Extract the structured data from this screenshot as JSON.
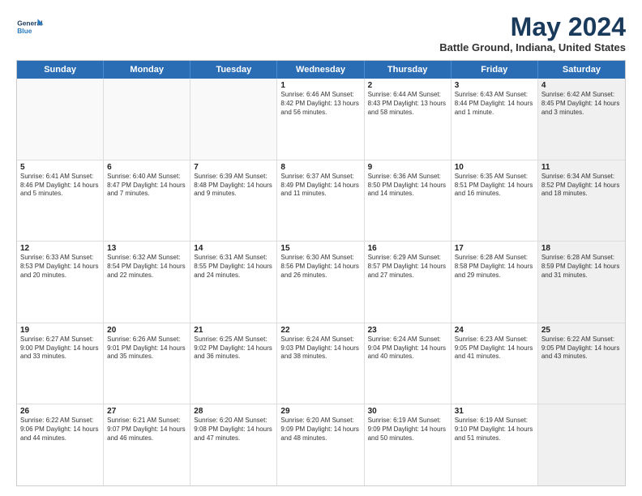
{
  "logo": {
    "line1": "General",
    "line2": "Blue"
  },
  "title": "May 2024",
  "subtitle": "Battle Ground, Indiana, United States",
  "header_days": [
    "Sunday",
    "Monday",
    "Tuesday",
    "Wednesday",
    "Thursday",
    "Friday",
    "Saturday"
  ],
  "rows": [
    [
      {
        "day": "",
        "text": "",
        "empty": true
      },
      {
        "day": "",
        "text": "",
        "empty": true
      },
      {
        "day": "",
        "text": "",
        "empty": true
      },
      {
        "day": "1",
        "text": "Sunrise: 6:46 AM\nSunset: 8:42 PM\nDaylight: 13 hours and 56 minutes."
      },
      {
        "day": "2",
        "text": "Sunrise: 6:44 AM\nSunset: 8:43 PM\nDaylight: 13 hours and 58 minutes."
      },
      {
        "day": "3",
        "text": "Sunrise: 6:43 AM\nSunset: 8:44 PM\nDaylight: 14 hours and 1 minute."
      },
      {
        "day": "4",
        "text": "Sunrise: 6:42 AM\nSunset: 8:45 PM\nDaylight: 14 hours and 3 minutes.",
        "shaded": true
      }
    ],
    [
      {
        "day": "5",
        "text": "Sunrise: 6:41 AM\nSunset: 8:46 PM\nDaylight: 14 hours and 5 minutes."
      },
      {
        "day": "6",
        "text": "Sunrise: 6:40 AM\nSunset: 8:47 PM\nDaylight: 14 hours and 7 minutes."
      },
      {
        "day": "7",
        "text": "Sunrise: 6:39 AM\nSunset: 8:48 PM\nDaylight: 14 hours and 9 minutes."
      },
      {
        "day": "8",
        "text": "Sunrise: 6:37 AM\nSunset: 8:49 PM\nDaylight: 14 hours and 11 minutes."
      },
      {
        "day": "9",
        "text": "Sunrise: 6:36 AM\nSunset: 8:50 PM\nDaylight: 14 hours and 14 minutes."
      },
      {
        "day": "10",
        "text": "Sunrise: 6:35 AM\nSunset: 8:51 PM\nDaylight: 14 hours and 16 minutes."
      },
      {
        "day": "11",
        "text": "Sunrise: 6:34 AM\nSunset: 8:52 PM\nDaylight: 14 hours and 18 minutes.",
        "shaded": true
      }
    ],
    [
      {
        "day": "12",
        "text": "Sunrise: 6:33 AM\nSunset: 8:53 PM\nDaylight: 14 hours and 20 minutes."
      },
      {
        "day": "13",
        "text": "Sunrise: 6:32 AM\nSunset: 8:54 PM\nDaylight: 14 hours and 22 minutes."
      },
      {
        "day": "14",
        "text": "Sunrise: 6:31 AM\nSunset: 8:55 PM\nDaylight: 14 hours and 24 minutes."
      },
      {
        "day": "15",
        "text": "Sunrise: 6:30 AM\nSunset: 8:56 PM\nDaylight: 14 hours and 26 minutes."
      },
      {
        "day": "16",
        "text": "Sunrise: 6:29 AM\nSunset: 8:57 PM\nDaylight: 14 hours and 27 minutes."
      },
      {
        "day": "17",
        "text": "Sunrise: 6:28 AM\nSunset: 8:58 PM\nDaylight: 14 hours and 29 minutes."
      },
      {
        "day": "18",
        "text": "Sunrise: 6:28 AM\nSunset: 8:59 PM\nDaylight: 14 hours and 31 minutes.",
        "shaded": true
      }
    ],
    [
      {
        "day": "19",
        "text": "Sunrise: 6:27 AM\nSunset: 9:00 PM\nDaylight: 14 hours and 33 minutes."
      },
      {
        "day": "20",
        "text": "Sunrise: 6:26 AM\nSunset: 9:01 PM\nDaylight: 14 hours and 35 minutes."
      },
      {
        "day": "21",
        "text": "Sunrise: 6:25 AM\nSunset: 9:02 PM\nDaylight: 14 hours and 36 minutes."
      },
      {
        "day": "22",
        "text": "Sunrise: 6:24 AM\nSunset: 9:03 PM\nDaylight: 14 hours and 38 minutes."
      },
      {
        "day": "23",
        "text": "Sunrise: 6:24 AM\nSunset: 9:04 PM\nDaylight: 14 hours and 40 minutes."
      },
      {
        "day": "24",
        "text": "Sunrise: 6:23 AM\nSunset: 9:05 PM\nDaylight: 14 hours and 41 minutes."
      },
      {
        "day": "25",
        "text": "Sunrise: 6:22 AM\nSunset: 9:05 PM\nDaylight: 14 hours and 43 minutes.",
        "shaded": true
      }
    ],
    [
      {
        "day": "26",
        "text": "Sunrise: 6:22 AM\nSunset: 9:06 PM\nDaylight: 14 hours and 44 minutes."
      },
      {
        "day": "27",
        "text": "Sunrise: 6:21 AM\nSunset: 9:07 PM\nDaylight: 14 hours and 46 minutes."
      },
      {
        "day": "28",
        "text": "Sunrise: 6:20 AM\nSunset: 9:08 PM\nDaylight: 14 hours and 47 minutes."
      },
      {
        "day": "29",
        "text": "Sunrise: 6:20 AM\nSunset: 9:09 PM\nDaylight: 14 hours and 48 minutes."
      },
      {
        "day": "30",
        "text": "Sunrise: 6:19 AM\nSunset: 9:09 PM\nDaylight: 14 hours and 50 minutes."
      },
      {
        "day": "31",
        "text": "Sunrise: 6:19 AM\nSunset: 9:10 PM\nDaylight: 14 hours and 51 minutes."
      },
      {
        "day": "",
        "text": "",
        "empty": true,
        "shaded": true
      }
    ]
  ]
}
